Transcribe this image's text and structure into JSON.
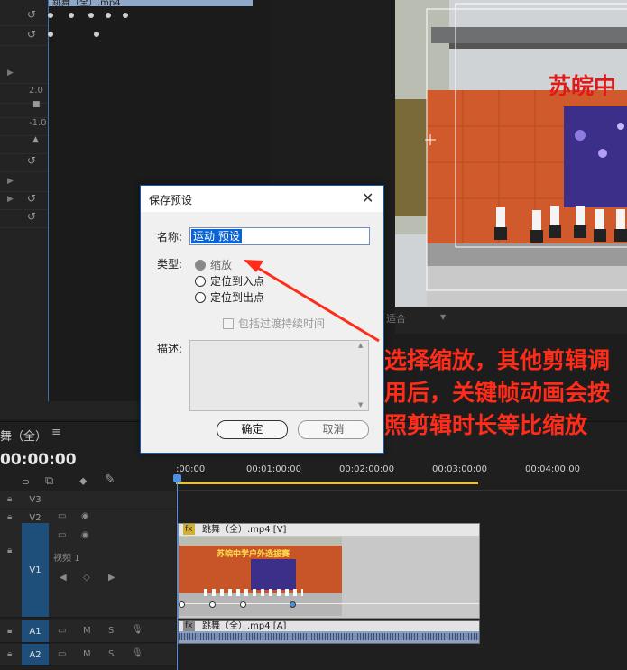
{
  "effect_controls": {
    "clip_name": "跳舞（全）.mp4",
    "value_top": "2.0",
    "value_bottom": "-1.0"
  },
  "dialog": {
    "title": "保存预设",
    "name_label": "名称:",
    "name_value": "运动 预设",
    "type_label": "类型:",
    "options": [
      "缩放",
      "定位到入点",
      "定位到出点"
    ],
    "selected_option": "缩放",
    "include_label": "包括过渡持续时间",
    "desc_label": "描述:",
    "ok_label": "确定",
    "cancel_label": "取消"
  },
  "monitor": {
    "banner_text": "苏皖中",
    "dropdown_text": "适合"
  },
  "annotation": {
    "text": "选择缩放，其他剪辑调用后，关键帧动画会按照剪辑时长等比缩放",
    "color": "#ff2c1a"
  },
  "timeline": {
    "sequence_title": "舞（全）",
    "timecode": "00:00:00",
    "ruler": [
      ":00:00",
      "00:01:00:00",
      "00:02:00:00",
      "00:03:00:00",
      "00:04:00:00"
    ],
    "tracks": [
      {
        "id": "V3",
        "type": "video"
      },
      {
        "id": "V2",
        "type": "video"
      },
      {
        "id": "V1",
        "type": "video",
        "track_name": "视频 1"
      },
      {
        "id": "A1",
        "type": "audio"
      },
      {
        "id": "A2",
        "type": "audio"
      }
    ],
    "video_clip_label": "跳舞（全）.mp4 [V]",
    "video_clip_thumb_text": "苏皖中学户外选拔赛",
    "audio_clip_label": "跳舞（全）.mp4 [A]",
    "mute_label": "M",
    "solo_label": "S"
  }
}
